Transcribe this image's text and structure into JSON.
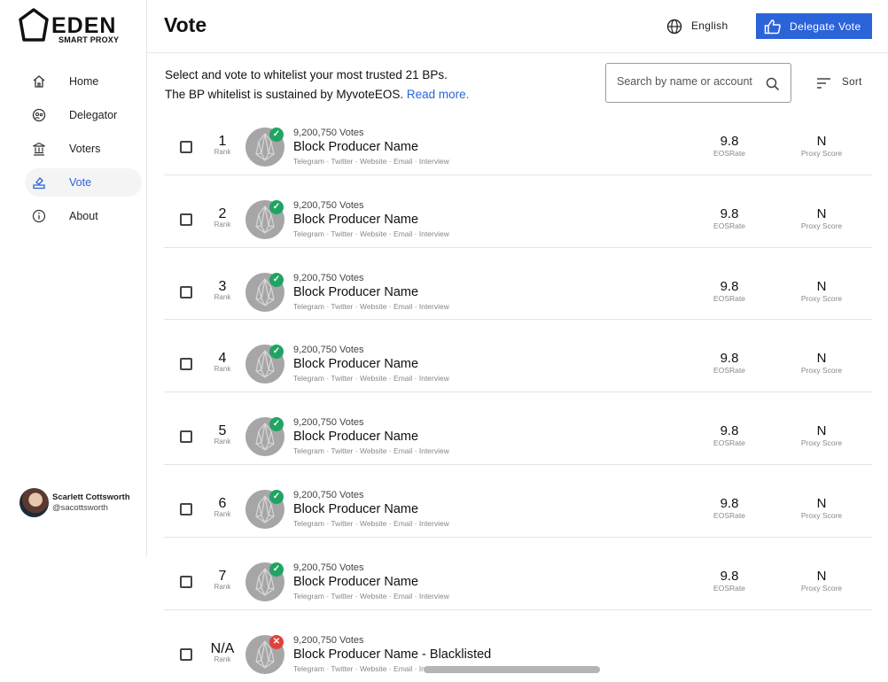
{
  "app": {
    "logo_text": "EDEN",
    "logo_sub": "SMART PROXY"
  },
  "sidebar": {
    "items": [
      {
        "label": "Home",
        "icon": "home-icon",
        "active": false
      },
      {
        "label": "Delegator",
        "icon": "delegator-icon",
        "active": false
      },
      {
        "label": "Voters",
        "icon": "bank-icon",
        "active": false
      },
      {
        "label": "Vote",
        "icon": "vote-icon",
        "active": true
      },
      {
        "label": "About",
        "icon": "info-icon",
        "active": false
      }
    ],
    "user": {
      "name": "Scarlett Cottsworth",
      "handle": "@sacottsworth"
    }
  },
  "header": {
    "title": "Vote",
    "language": "English",
    "delegate_label": "Delegate Vote"
  },
  "intro": {
    "line1": "Select and vote to whitelist your most trusted 21 BPs.",
    "line2": "The BP whitelist is sustained by MyvoteEOS.",
    "read_more": "Read more."
  },
  "search": {
    "placeholder": "Search by name or account"
  },
  "sort": {
    "label": "Sort"
  },
  "labels": {
    "rank": "Rank",
    "eosrate": "EOSRate",
    "proxy_score": "Proxy Score"
  },
  "producers": [
    {
      "rank": "1",
      "votes": "9,200,750 Votes",
      "name": "Block Producer Name",
      "links": "Telegram · Twitter · Website · Email · Interview",
      "eosrate": "9.8",
      "proxy_score": "N",
      "status": "ok"
    },
    {
      "rank": "2",
      "votes": "9,200,750 Votes",
      "name": "Block Producer Name",
      "links": "Telegram · Twitter · Website · Email · Interview",
      "eosrate": "9.8",
      "proxy_score": "N",
      "status": "ok"
    },
    {
      "rank": "3",
      "votes": "9,200,750 Votes",
      "name": "Block Producer Name",
      "links": "Telegram · Twitter · Website · Email · Interview",
      "eosrate": "9.8",
      "proxy_score": "N",
      "status": "ok"
    },
    {
      "rank": "4",
      "votes": "9,200,750 Votes",
      "name": "Block Producer Name",
      "links": "Telegram · Twitter · Website · Email · Interview",
      "eosrate": "9.8",
      "proxy_score": "N",
      "status": "ok"
    },
    {
      "rank": "5",
      "votes": "9,200,750 Votes",
      "name": "Block Producer Name",
      "links": "Telegram · Twitter · Website · Email · Interview",
      "eosrate": "9.8",
      "proxy_score": "N",
      "status": "ok"
    },
    {
      "rank": "6",
      "votes": "9,200,750 Votes",
      "name": "Block Producer Name",
      "links": "Telegram · Twitter · Website · Email · Interview",
      "eosrate": "9.8",
      "proxy_score": "N",
      "status": "ok"
    },
    {
      "rank": "7",
      "votes": "9,200,750 Votes",
      "name": "Block Producer Name",
      "links": "Telegram · Twitter · Website · Email · Interview",
      "eosrate": "9.8",
      "proxy_score": "N",
      "status": "ok"
    },
    {
      "rank": "N/A",
      "votes": "9,200,750 Votes",
      "name": "Block Producer Name - Blacklisted",
      "links": "Telegram · Twitter · Website · Email · Interview",
      "eosrate": "",
      "proxy_score": "",
      "status": "blacklisted"
    }
  ],
  "colors": {
    "accent": "#2b63d9",
    "ok": "#20a464",
    "blacklisted": "#e0423a"
  }
}
